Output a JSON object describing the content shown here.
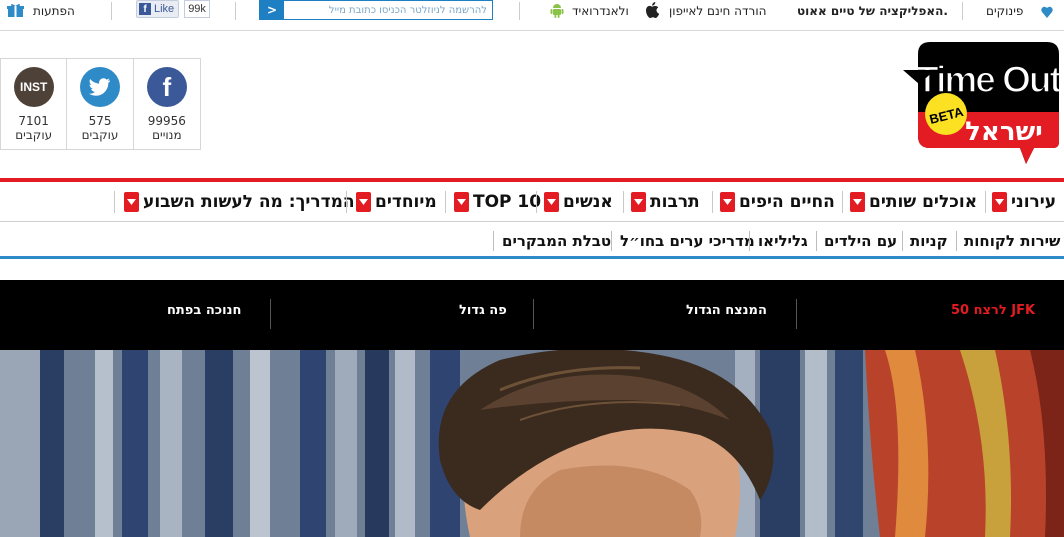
{
  "topbar": {
    "openings_label": "הפתעות",
    "facebook_like_label": "Like",
    "facebook_like_count": "99k",
    "newsletter_placeholder": "להרשמה לניוזלטר הכניסו כתובת מייל",
    "android_label": "ולאנדרואיד",
    "app_text_bold": "האפליקציה של טיים אאוט.",
    "app_text": "הורדה חינם לאייפון",
    "pinuks_label": "פינוקים"
  },
  "logo": {
    "wordmark": "Time Out",
    "badge": "BETA",
    "country": "ישראל"
  },
  "social": [
    {
      "name": "facebook",
      "icon": "facebook-icon",
      "glyph": "f",
      "count": "99956",
      "label": "מנויים",
      "color": "#3b5998"
    },
    {
      "name": "twitter",
      "icon": "twitter-icon",
      "glyph": "",
      "count": "575",
      "label": "עוקבים",
      "color": "#2f8ac8"
    },
    {
      "name": "instagram",
      "icon": "instagram-icon",
      "glyph": "INST",
      "count": "7101",
      "label": "עוקבים",
      "color": "#4e4138"
    }
  ],
  "main_nav": [
    {
      "label": "עירוני"
    },
    {
      "label": "אוכלים שותים"
    },
    {
      "label": "החיים היפים"
    },
    {
      "label": "תרבות"
    },
    {
      "label": "אנשים"
    },
    {
      "label": "TOP 10"
    },
    {
      "label": "מיוחדים"
    },
    {
      "label": "המדריך: מה לעשות השבוע"
    }
  ],
  "sub_nav": [
    {
      "label": "שירות לקוחות"
    },
    {
      "label": "קניות"
    },
    {
      "label": "עם הילדים"
    },
    {
      "label": "גליליאו"
    },
    {
      "label": "מדריכי ערים בחו״ל"
    },
    {
      "label": "טבלת המבקרים"
    }
  ],
  "feature_tabs": [
    {
      "label": "50 לרצח JFK",
      "active": true
    },
    {
      "label": "המנצח הגדול",
      "active": false
    },
    {
      "label": "פה גדול",
      "active": false
    },
    {
      "label": "חנוכה בפתח",
      "active": false
    }
  ],
  "colors": {
    "accent_red": "#e31b23",
    "accent_blue": "#2f8ac8",
    "tabs_bg": "#000000"
  }
}
